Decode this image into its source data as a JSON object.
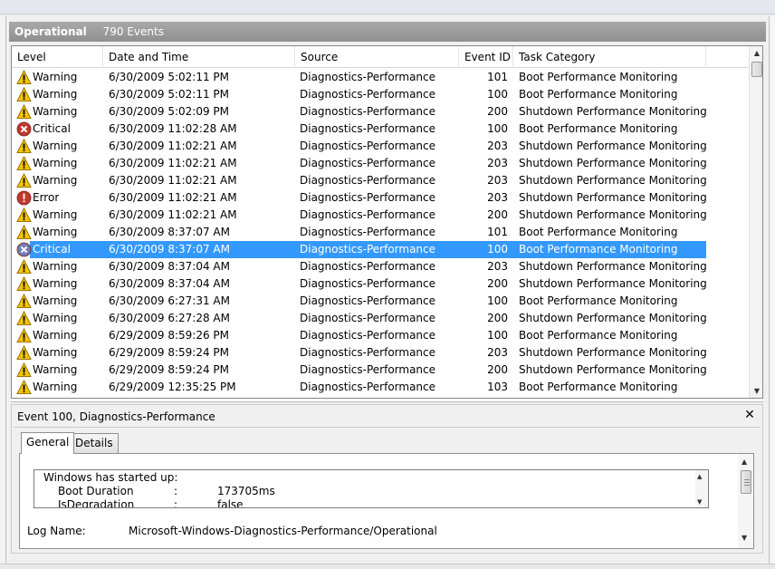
{
  "panel": {
    "title": "Operational",
    "count": "790 Events"
  },
  "columns": {
    "level": "Level",
    "date": "Date and Time",
    "source": "Source",
    "event_id": "Event ID",
    "task": "Task Category"
  },
  "rows": [
    {
      "level": "Warning",
      "icon": "warning-icon",
      "date": "6/30/2009 5:02:11 PM",
      "source": "Diagnostics-Performance",
      "id": "101",
      "task": "Boot Performance Monitoring"
    },
    {
      "level": "Warning",
      "icon": "warning-icon",
      "date": "6/30/2009 5:02:11 PM",
      "source": "Diagnostics-Performance",
      "id": "100",
      "task": "Boot Performance Monitoring"
    },
    {
      "level": "Warning",
      "icon": "warning-icon",
      "date": "6/30/2009 5:02:09 PM",
      "source": "Diagnostics-Performance",
      "id": "200",
      "task": "Shutdown Performance Monitoring"
    },
    {
      "level": "Critical",
      "icon": "critical-icon",
      "date": "6/30/2009 11:02:28 AM",
      "source": "Diagnostics-Performance",
      "id": "100",
      "task": "Boot Performance Monitoring"
    },
    {
      "level": "Warning",
      "icon": "warning-icon",
      "date": "6/30/2009 11:02:21 AM",
      "source": "Diagnostics-Performance",
      "id": "203",
      "task": "Shutdown Performance Monitoring"
    },
    {
      "level": "Warning",
      "icon": "warning-icon",
      "date": "6/30/2009 11:02:21 AM",
      "source": "Diagnostics-Performance",
      "id": "203",
      "task": "Shutdown Performance Monitoring"
    },
    {
      "level": "Warning",
      "icon": "warning-icon",
      "date": "6/30/2009 11:02:21 AM",
      "source": "Diagnostics-Performance",
      "id": "203",
      "task": "Shutdown Performance Monitoring"
    },
    {
      "level": "Error",
      "icon": "error-icon",
      "date": "6/30/2009 11:02:21 AM",
      "source": "Diagnostics-Performance",
      "id": "203",
      "task": "Shutdown Performance Monitoring"
    },
    {
      "level": "Warning",
      "icon": "warning-icon",
      "date": "6/30/2009 11:02:21 AM",
      "source": "Diagnostics-Performance",
      "id": "200",
      "task": "Shutdown Performance Monitoring"
    },
    {
      "level": "Warning",
      "icon": "warning-icon",
      "date": "6/30/2009 8:37:07 AM",
      "source": "Diagnostics-Performance",
      "id": "101",
      "task": "Boot Performance Monitoring"
    },
    {
      "level": "Critical",
      "icon": "critical-icon",
      "date": "6/30/2009 8:37:07 AM",
      "source": "Diagnostics-Performance",
      "id": "100",
      "task": "Boot Performance Monitoring",
      "selected": true
    },
    {
      "level": "Warning",
      "icon": "warning-icon",
      "date": "6/30/2009 8:37:04 AM",
      "source": "Diagnostics-Performance",
      "id": "203",
      "task": "Shutdown Performance Monitoring"
    },
    {
      "level": "Warning",
      "icon": "warning-icon",
      "date": "6/30/2009 8:37:04 AM",
      "source": "Diagnostics-Performance",
      "id": "200",
      "task": "Shutdown Performance Monitoring"
    },
    {
      "level": "Warning",
      "icon": "warning-icon",
      "date": "6/30/2009 6:27:31 AM",
      "source": "Diagnostics-Performance",
      "id": "100",
      "task": "Boot Performance Monitoring"
    },
    {
      "level": "Warning",
      "icon": "warning-icon",
      "date": "6/30/2009 6:27:28 AM",
      "source": "Diagnostics-Performance",
      "id": "200",
      "task": "Shutdown Performance Monitoring"
    },
    {
      "level": "Warning",
      "icon": "warning-icon",
      "date": "6/29/2009 8:59:26 PM",
      "source": "Diagnostics-Performance",
      "id": "100",
      "task": "Boot Performance Monitoring"
    },
    {
      "level": "Warning",
      "icon": "warning-icon",
      "date": "6/29/2009 8:59:24 PM",
      "source": "Diagnostics-Performance",
      "id": "203",
      "task": "Shutdown Performance Monitoring"
    },
    {
      "level": "Warning",
      "icon": "warning-icon",
      "date": "6/29/2009 8:59:24 PM",
      "source": "Diagnostics-Performance",
      "id": "200",
      "task": "Shutdown Performance Monitoring"
    },
    {
      "level": "Warning",
      "icon": "warning-icon",
      "date": "6/29/2009 12:35:25 PM",
      "source": "Diagnostics-Performance",
      "id": "103",
      "task": "Boot Performance Monitoring"
    }
  ],
  "detail": {
    "title": "Event 100, Diagnostics-Performance",
    "close_icon": "close-icon",
    "tabs": [
      {
        "label": "General",
        "active": true
      },
      {
        "label": "Details",
        "active": false
      }
    ],
    "message": {
      "line1": "Windows has started up:",
      "boot_key": "Boot Duration",
      "boot_sep": ":",
      "boot_val": "173705ms",
      "deg_key": "IsDegradation",
      "deg_sep": ":",
      "deg_val": "false"
    },
    "log_name_label": "Log Name:",
    "log_name_value": "Microsoft-Windows-Diagnostics-Performance/Operational"
  },
  "colors": {
    "selection": "#3399ff",
    "header_bar": "#9a9a9a",
    "warning": "#f5c400",
    "critical": "#c0392b",
    "error": "#c0392b"
  }
}
